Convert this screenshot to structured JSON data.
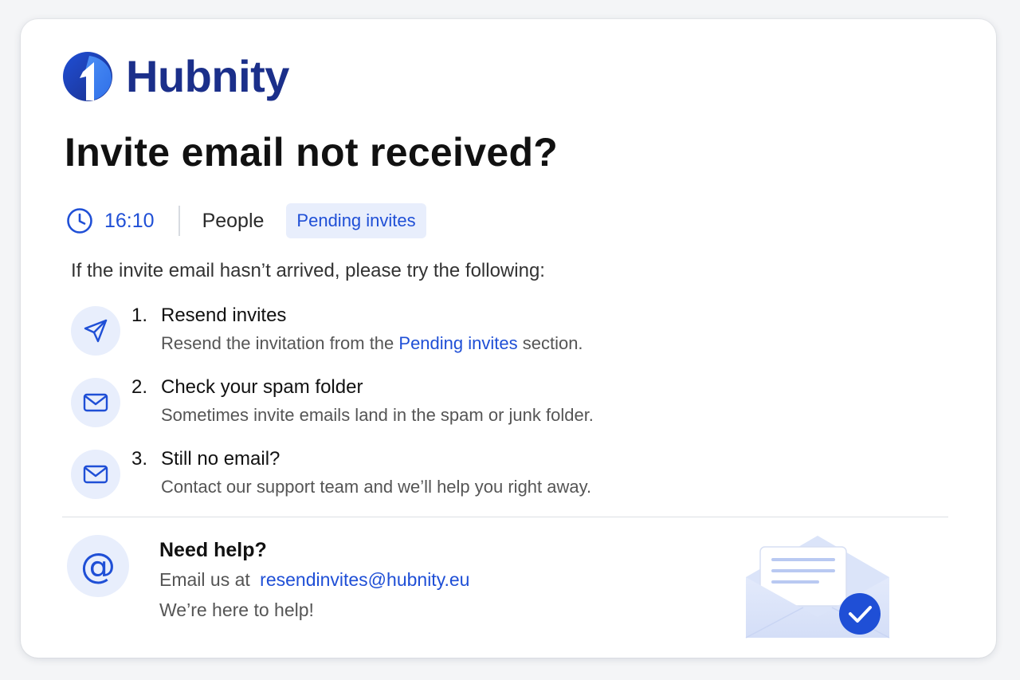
{
  "brand": {
    "name": "Hubnity",
    "color": "#1b2f8a"
  },
  "article": {
    "title": "Invite email not received?",
    "time": "16:10",
    "section": "People",
    "tag": "Pending invites",
    "intro": "If the invite email hasn’t arrived, please try the following:"
  },
  "steps": [
    {
      "number": "1.",
      "title": "Resend invites",
      "desc_before": "Resend the invitation from the ",
      "desc_link": "Pending invites",
      "desc_after": " section.",
      "icon": "send-icon"
    },
    {
      "number": "2.",
      "title": "Check your spam folder",
      "desc": "Sometimes invite emails land in the spam or junk folder.",
      "icon": "mail-icon"
    },
    {
      "number": "3.",
      "title": "Still no email?",
      "desc": "Contact our support team and we’ll help you right away.",
      "icon": "mail-icon"
    }
  ],
  "help": {
    "title": "Need help?",
    "email_prefix": "Email us at",
    "email": "resendinvites@hubnity.eu",
    "note": "We’re here to help!",
    "icon": "at-icon"
  },
  "colors": {
    "accent": "#1f4fd6",
    "icon_bg": "#e8eefc"
  }
}
